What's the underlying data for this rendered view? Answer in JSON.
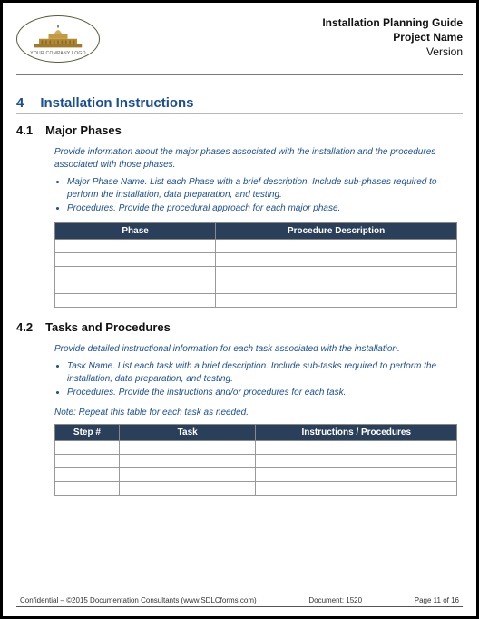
{
  "header": {
    "logo_caption": "YOUR COMPANY LOGO",
    "title_line1": "Installation Planning Guide",
    "title_line2": "Project Name",
    "title_line3": "Version"
  },
  "section": {
    "num": "4",
    "title": "Installation Instructions"
  },
  "sub1": {
    "num": "4.1",
    "title": "Major Phases",
    "intro": "Provide information about the major phases associated with the installation and the procedures associated with those phases.",
    "bullet1": "Major Phase Name. List each Phase with a brief description. Include sub-phases required to perform the installation, data preparation, and testing.",
    "bullet2": "Procedures. Provide the procedural approach for each major phase.",
    "col1": "Phase",
    "col2": "Procedure Description"
  },
  "sub2": {
    "num": "4.2",
    "title": "Tasks and Procedures",
    "intro": "Provide detailed instructional information for each task associated with the installation.",
    "bullet1": "Task Name. List each task with a brief description. Include sub-tasks required to perform the installation, data preparation, and testing.",
    "bullet2": "Procedures. Provide the instructions and/or procedures for each task.",
    "note": "Note: Repeat this table for each task as needed.",
    "col1": "Step #",
    "col2": "Task",
    "col3": "Instructions / Procedures"
  },
  "footer": {
    "left": "Confidential – ©2015 Documentation Consultants (www.SDLCforms.com)",
    "doc": "Document: 1520",
    "page": "Page 11 of 16"
  }
}
